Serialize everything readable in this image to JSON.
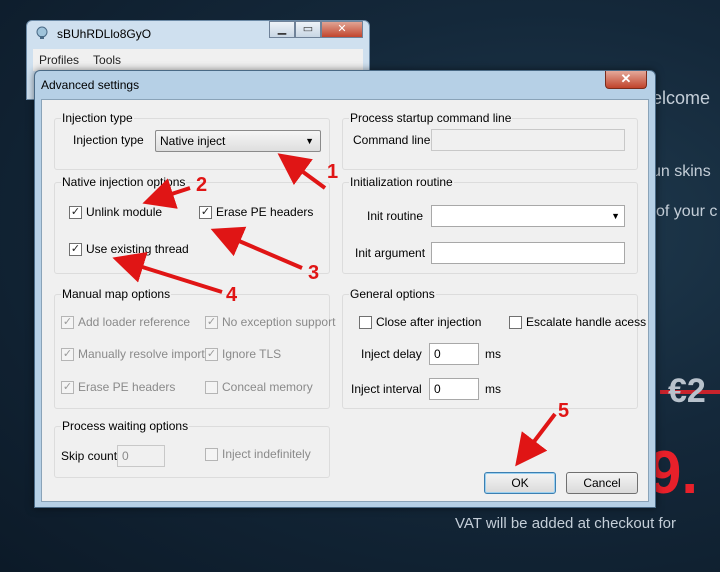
{
  "background": {
    "welcome": "elcome",
    "skins": "un skins",
    "ofyour": "of your c",
    "euro": "€2",
    "price": "9.",
    "vat": "VAT will be added at checkout for"
  },
  "back_window": {
    "title": "sBUhRDLlo8GyO",
    "menu": [
      "Profiles",
      "Tools"
    ]
  },
  "dialog": {
    "title": "Advanced settings",
    "close_glyph": "✕",
    "injection_type": {
      "group_title": "Injection type",
      "label": "Injection type",
      "value": "Native inject"
    },
    "startup": {
      "group_title": "Process startup command line",
      "label": "Command line",
      "value": ""
    },
    "native_options": {
      "group_title": "Native injection options",
      "unlink_module": "Unlink module",
      "erase_pe_headers": "Erase PE headers",
      "use_existing_thread": "Use existing thread"
    },
    "init_routine": {
      "group_title": "Initialization routine",
      "routine_label": "Init routine",
      "routine_value": "",
      "argument_label": "Init argument",
      "argument_value": ""
    },
    "manual_map": {
      "group_title": "Manual map options",
      "add_loader_reference": "Add loader reference",
      "no_exception_support": "No exception support",
      "manually_resolve_imports": "Manually resolve imports",
      "ignore_tls": "Ignore TLS",
      "erase_pe_headers": "Erase PE headers",
      "conceal_memory": "Conceal memory"
    },
    "general": {
      "group_title": "General options",
      "close_after_injection": "Close after injection",
      "escalate_handle_access": "Escalate handle acess",
      "inject_delay_label": "Inject delay",
      "inject_delay_value": "0",
      "inject_delay_unit": "ms",
      "inject_interval_label": "Inject interval",
      "inject_interval_value": "0",
      "inject_interval_unit": "ms"
    },
    "waiting": {
      "group_title": "Process waiting options",
      "skip_count_label": "Skip count",
      "skip_count_value": "0",
      "inject_indefinitely": "Inject indefinitely"
    },
    "buttons": {
      "ok": "OK",
      "cancel": "Cancel"
    }
  },
  "annotations": [
    "1",
    "2",
    "3",
    "4",
    "5"
  ],
  "colors": {
    "annotation": "#e01515",
    "dialog_frame": "#b6d0e6",
    "client": "#f0f0f0"
  }
}
